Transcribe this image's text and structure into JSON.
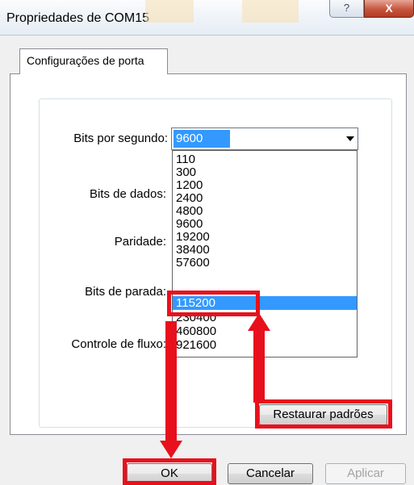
{
  "window": {
    "title": "Propriedades de COM15",
    "help_glyph": "?",
    "close_glyph": "X"
  },
  "tabs": [
    "Configurações de porta"
  ],
  "fields": {
    "bits_por_segundo": "Bits por segundo:",
    "bits_de_dados": "Bits de dados:",
    "paridade": "Paridade:",
    "bits_de_parada": "Bits de parada:",
    "controle_de_fluxo": "Controle de fluxo:"
  },
  "combo": {
    "value": "9600",
    "options": [
      "110",
      "300",
      "1200",
      "2400",
      "4800",
      "9600",
      "19200",
      "38400",
      "57600",
      "115200",
      "230400",
      "460800",
      "921600"
    ],
    "highlighted": "115200"
  },
  "buttons": {
    "restore": "Restaurar padrões",
    "ok": "OK",
    "cancel": "Cancelar",
    "apply": "Aplicar"
  },
  "colors": {
    "selection": "#3399ff",
    "annotation": "#e8101c"
  }
}
